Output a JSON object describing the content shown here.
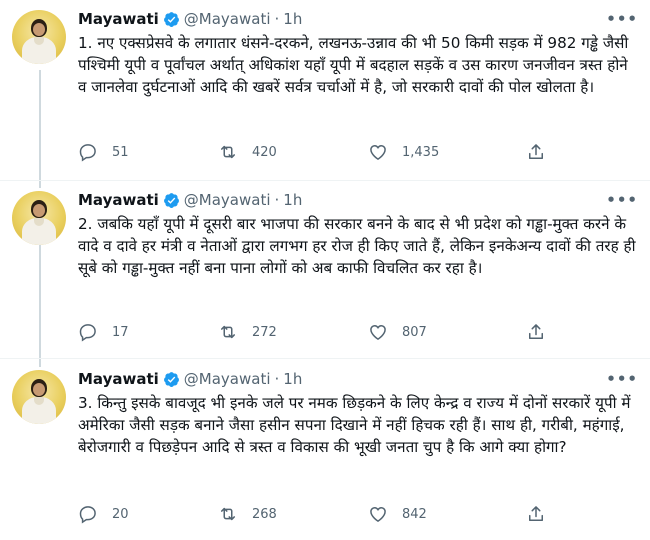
{
  "tweets": [
    {
      "name": "Mayawati",
      "handle": "@Mayawati",
      "separator": "·",
      "time": "1h",
      "text": "1. नए एक्सप्रेसवे के लगातार धंसने-दरकने, लखनऊ-उन्नाव की भी 50 किमी सड़क में 982 गड्ढे जैसी पश्चिमी यूपी व पूर्वांचल अर्थात् अधिकांश यहाँ यूपी में बदहाल सड़कें व उस कारण जनजीवन त्रस्त होने व जानलेवा दुर्घटनाओं आदि की खबरें सर्वत्र चर्चाओं में है, जो सरकारी दावों की पोल खोलता है।",
      "replies": "51",
      "retweets": "420",
      "likes": "1,435"
    },
    {
      "name": "Mayawati",
      "handle": "@Mayawati",
      "separator": "·",
      "time": "1h",
      "text": "2. जबकि यहाँ यूपी में दूसरी बार भाजपा की सरकार बनने के बाद से भी प्रदेश को गड्ढा-मुक्त करने के वादे व दावे हर मंत्री व नेताओं द्वारा लगभग हर रोज ही किए जाते हैं, लेकिन इनकेअन्य दावों की तरह ही सूबे को गड्ढा-मुक्त नहीं बना पाना लोगों को अब काफी विचलित कर रहा है।",
      "replies": "17",
      "retweets": "272",
      "likes": "807"
    },
    {
      "name": "Mayawati",
      "handle": "@Mayawati",
      "separator": "·",
      "time": "1h",
      "text": "3. किन्तु इसके बावजूद भी इनके जले पर नमक छिड़कने के लिए केन्द्र व राज्य में दोनों सरकारें यूपी में अमेरिका जैसी सड़क बनाने जैसा हसीन सपना दिखाने में नहीं हिचक रही हैं। साथ ही, गरीबी, महंगाई, बेरोजगारी व पिछड़ेपन आदि से त्रस्त व विकास की भूखी जनता चुप है कि आगे क्या होगा?",
      "replies": "20",
      "retweets": "268",
      "likes": "842"
    }
  ],
  "icons": {
    "more": "more-icon",
    "verified": "verified-badge-icon",
    "reply": "reply-icon",
    "retweet": "retweet-icon",
    "like": "heart-icon",
    "share": "share-icon"
  },
  "colors": {
    "text": "#0f1419",
    "secondary": "#536471",
    "verified": "#1d9bf0",
    "thread_line": "#cfd9de"
  }
}
